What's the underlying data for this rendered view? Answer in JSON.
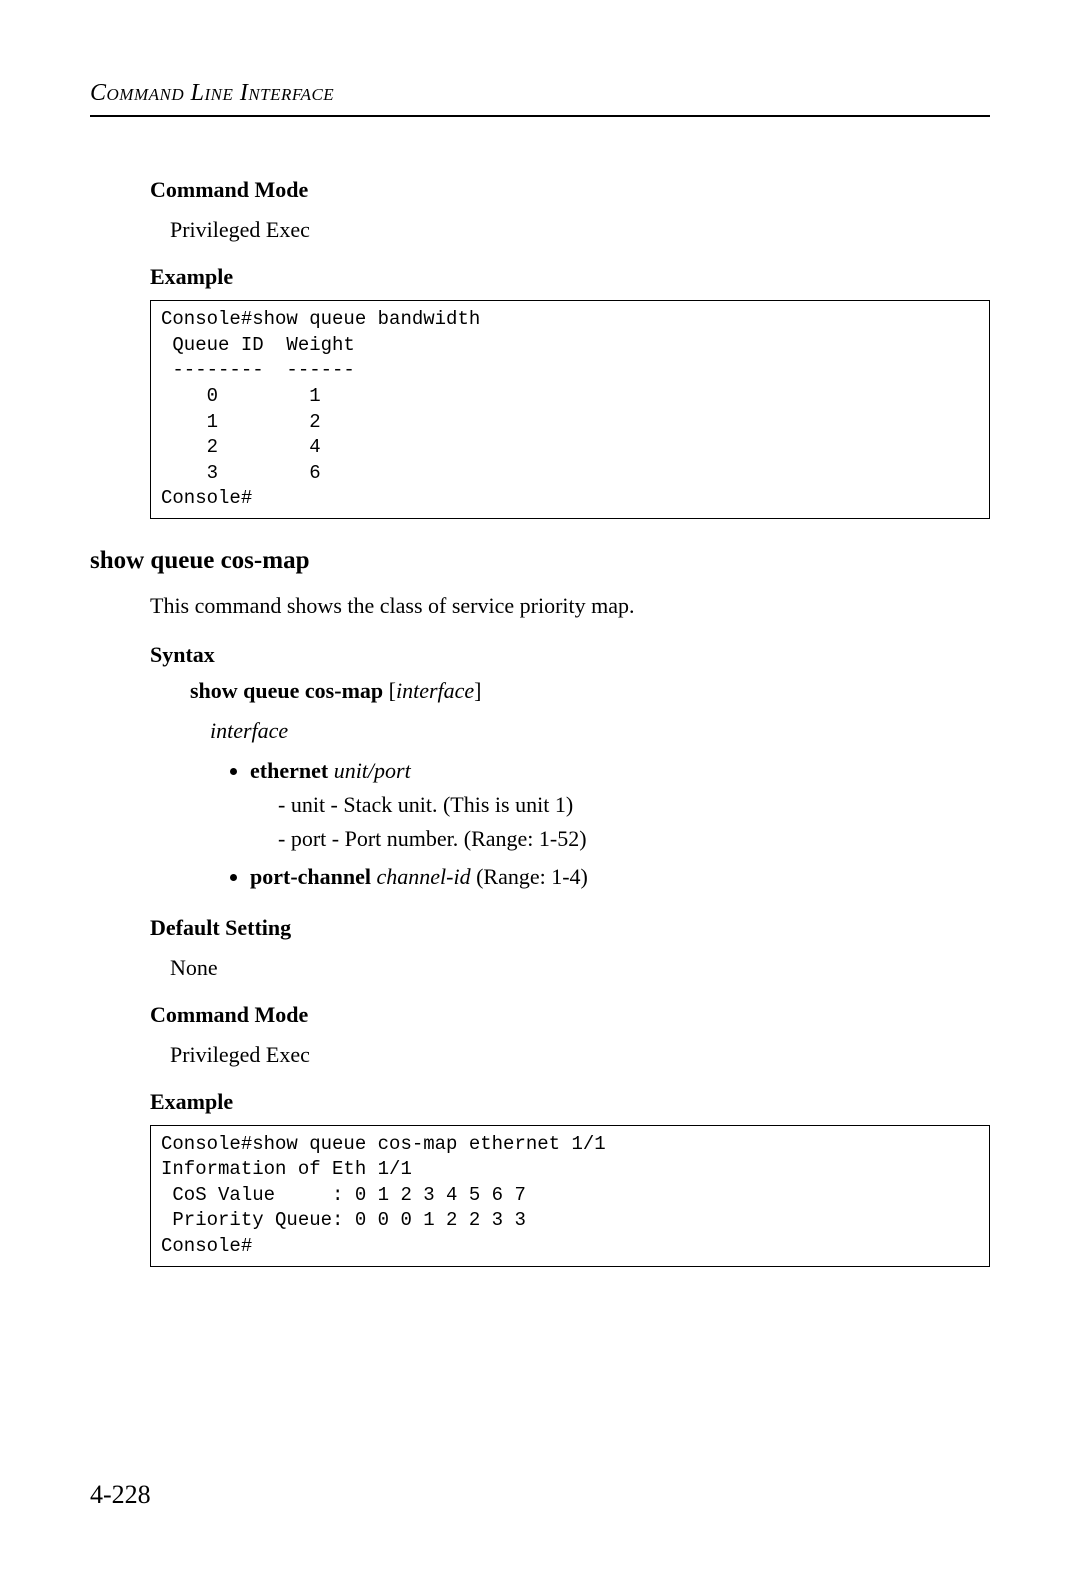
{
  "header": {
    "running_head": "Command Line Interface"
  },
  "top": {
    "command_mode_label": "Command Mode",
    "command_mode_value": "Privileged Exec",
    "example_label": "Example",
    "example_code": "Console#show queue bandwidth\n Queue ID  Weight\n --------  ------\n    0        1\n    1        2\n    2        4\n    3        6\nConsole#"
  },
  "cmd": {
    "heading": "show queue cos-map",
    "description": "This command shows the class of service priority map.",
    "syntax_label": "Syntax",
    "syntax_cmd_bold": "show queue cos-map",
    "syntax_cmd_open": " [",
    "syntax_cmd_ital": "interface",
    "syntax_cmd_close": "]",
    "interface_word": "interface",
    "bullet_eth_bold": "ethernet",
    "bullet_eth_ital": " unit/port",
    "bullet_eth_sub1": "- unit - Stack unit. (This is unit 1)",
    "bullet_eth_sub2": "- port - Port number. (Range: 1-52)",
    "bullet_pc_bold": "port-channel",
    "bullet_pc_ital": " channel-id",
    "bullet_pc_tail": " (Range: 1-4)",
    "default_label": "Default Setting",
    "default_value": "None",
    "command_mode_label": "Command Mode",
    "command_mode_value": "Privileged Exec",
    "example_label": "Example",
    "example_code": "Console#show queue cos-map ethernet 1/1\nInformation of Eth 1/1\n CoS Value     : 0 1 2 3 4 5 6 7\n Priority Queue: 0 0 0 1 2 2 3 3\nConsole#"
  },
  "footer": {
    "page_number": "4-228"
  }
}
